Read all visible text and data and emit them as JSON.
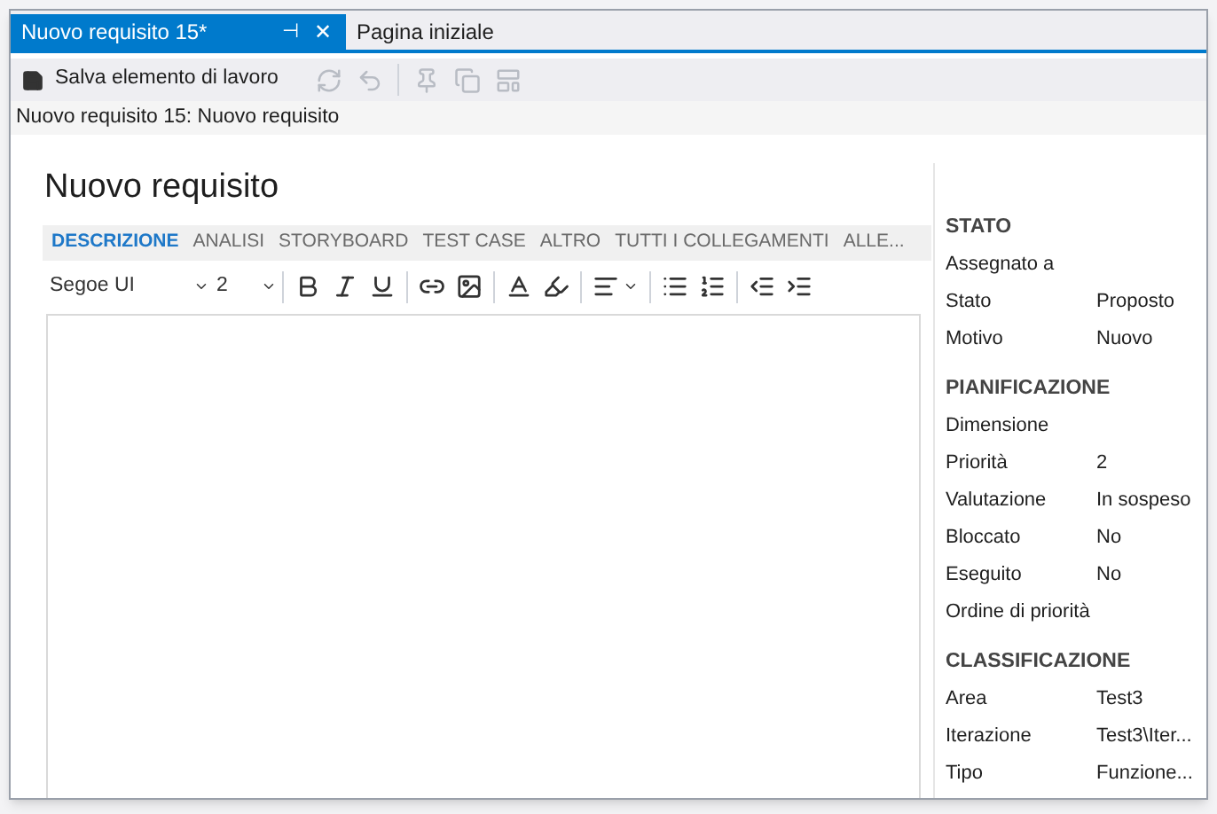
{
  "doc_tabs": [
    {
      "label": "Nuovo requisito 15*",
      "selected": true,
      "pin": "⊣",
      "close": "✕"
    },
    {
      "label": "Pagina iniziale",
      "selected": false
    }
  ],
  "toolbar": {
    "save_label": "Salva elemento di lavoro",
    "buttons": [
      {
        "kind": "refresh",
        "disabled": true
      },
      {
        "kind": "undo",
        "disabled": true
      },
      {
        "sep": true,
        "kind": "pin",
        "disabled": true
      },
      {
        "kind": "copy",
        "disabled": true
      },
      {
        "kind": "template",
        "disabled": true
      }
    ]
  },
  "breadcrumb": "Nuovo requisito 15: Nuovo requisito",
  "form_title": "Nuovo requisito",
  "form_tabs": [
    {
      "label": "DESCRIZIONE",
      "selected": true
    },
    {
      "label": "ANALISI",
      "selected": false
    },
    {
      "label": "STORYBOARD",
      "selected": false
    },
    {
      "label": "TEST CASE",
      "selected": false
    },
    {
      "label": "ALTRO",
      "selected": false
    },
    {
      "label": "TUTTI I COLLEGAMENTI",
      "selected": false
    },
    {
      "label": "ALLE...",
      "selected": false
    }
  ],
  "editor": {
    "font": "Segoe UI",
    "size": "2"
  },
  "sections": [
    {
      "title": "STATO",
      "fields": [
        {
          "label": "Assegnato a"
        },
        {
          "label": "Stato",
          "value": "Proposto"
        },
        {
          "label": "Motivo",
          "value": "Nuovo"
        }
      ]
    },
    {
      "title": "PIANIFICAZIONE",
      "fields": [
        {
          "label": "Dimensione"
        },
        {
          "label": "Priorità",
          "value": "2"
        },
        {
          "label": "Valutazione",
          "value": "In sospeso"
        },
        {
          "label": "Bloccato",
          "value": "No"
        },
        {
          "label": "Eseguito",
          "value": "No"
        },
        {
          "label": "Ordine di priorità"
        }
      ]
    },
    {
      "title": "CLASSIFICAZIONE",
      "fields": [
        {
          "label": "Area",
          "value": "Test3"
        },
        {
          "label": "Iterazione",
          "value": "Test3\\Iter..."
        },
        {
          "label": "Tipo",
          "value": "Funzione..."
        }
      ]
    }
  ]
}
